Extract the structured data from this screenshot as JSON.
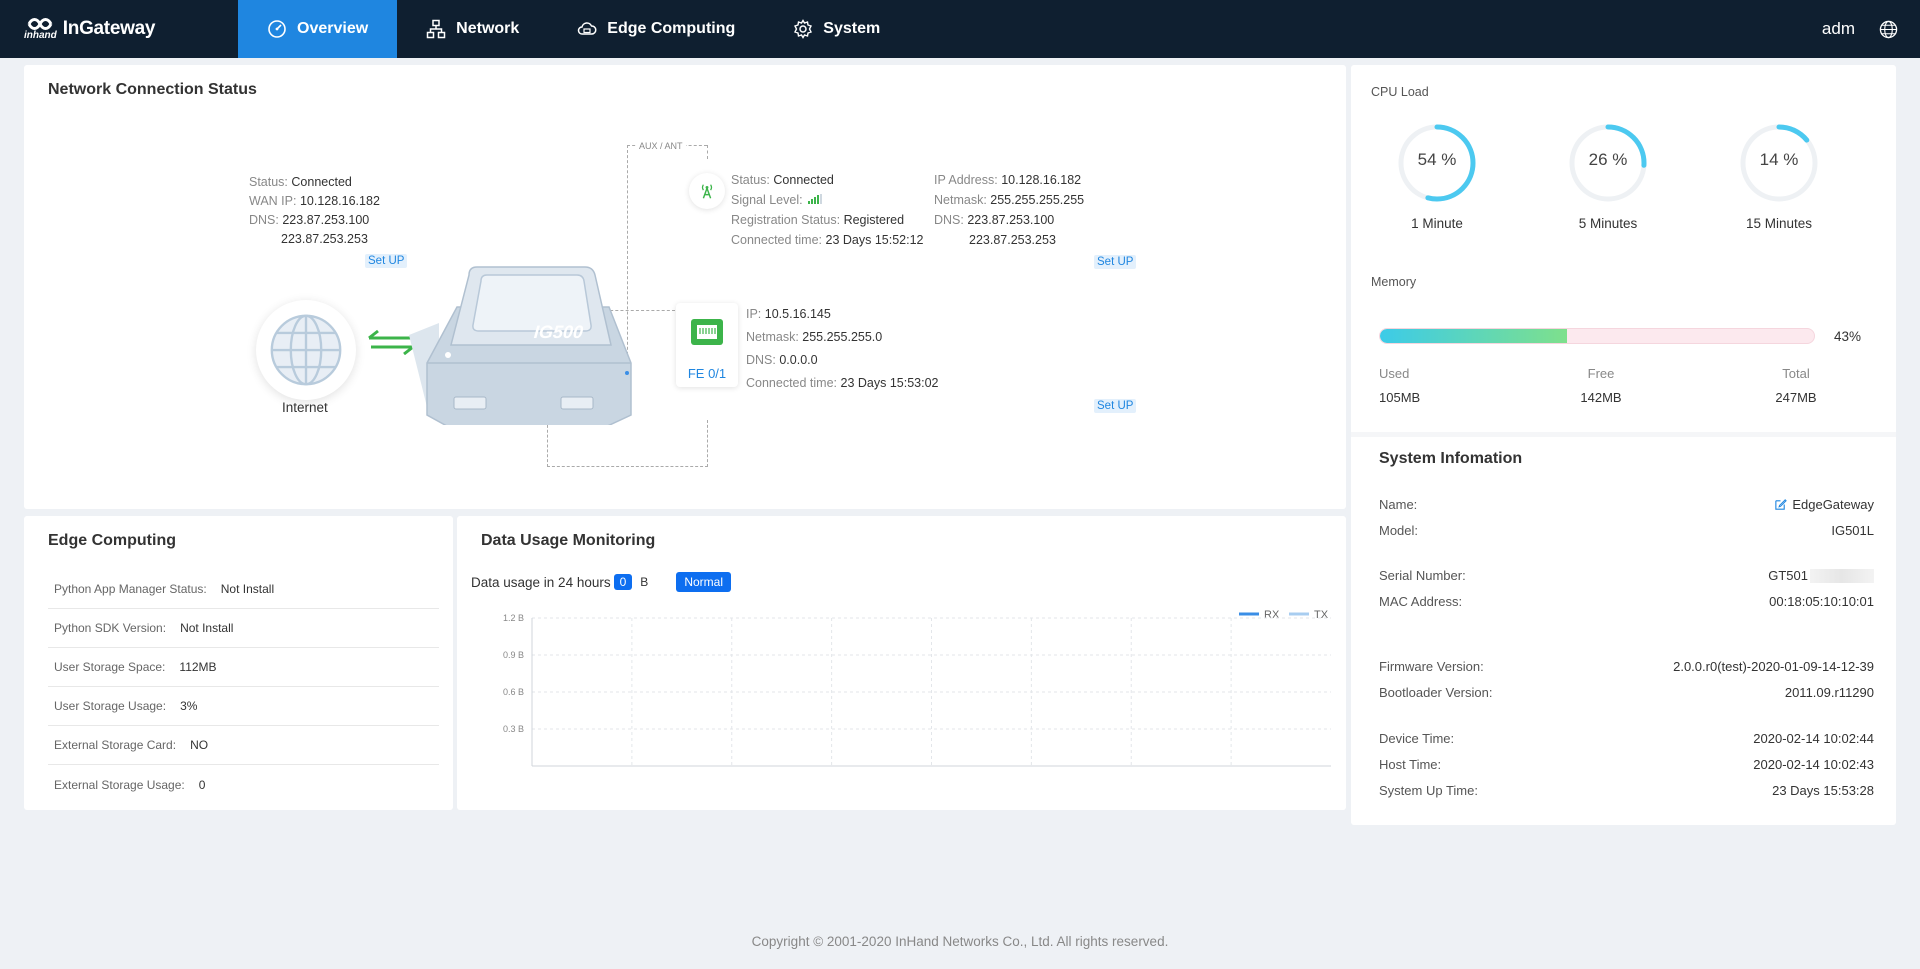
{
  "brand": {
    "logo_mark": "inhand",
    "name": "InGateway"
  },
  "nav": {
    "items": [
      {
        "label": "Overview",
        "icon": "dashboard-icon",
        "active": true
      },
      {
        "label": "Network",
        "icon": "network-icon"
      },
      {
        "label": "Edge Computing",
        "icon": "cloud-icon"
      },
      {
        "label": "System",
        "icon": "gear-icon"
      }
    ],
    "user": "adm"
  },
  "network_status": {
    "title": "Network Connection Status",
    "aux_label": "AUX / ANT",
    "device_label": "IG500",
    "internet_label": "Internet",
    "wan": {
      "status_k": "Status:",
      "status_v": "Connected",
      "ip_k": "WAN IP:",
      "ip_v": "10.128.16.182",
      "dns_k": "DNS:",
      "dns_v1": "223.87.253.100",
      "dns_v2": "223.87.253.253",
      "setup": "Set UP"
    },
    "cellular": {
      "status_k": "Status:",
      "status_v": "Connected",
      "signal_k": "Signal Level:",
      "signal_bars": 4,
      "reg_k": "Registration Status:",
      "reg_v": "Registered",
      "time_k": "Connected time:",
      "time_v": "23 Days 15:52:12",
      "ip_k": "IP Address:",
      "ip_v": "10.128.16.182",
      "mask_k": "Netmask:",
      "mask_v": "255.255.255.255",
      "dns_k": "DNS:",
      "dns_v1": "223.87.253.100",
      "dns_v2": "223.87.253.253",
      "setup": "Set UP"
    },
    "lan": {
      "port": "FE 0/1",
      "ip_k": "IP:",
      "ip_v": "10.5.16.145",
      "mask_k": "Netmask:",
      "mask_v": "255.255.255.0",
      "dns_k": "DNS:",
      "dns_v": "0.0.0.0",
      "time_k": "Connected time:",
      "time_v": "23 Days 15:53:02",
      "setup": "Set UP"
    }
  },
  "edge": {
    "title": "Edge Computing",
    "rows": [
      {
        "k": "Python App Manager Status:",
        "v": "Not Install"
      },
      {
        "k": "Python SDK Version:",
        "v": "Not Install"
      },
      {
        "k": "User Storage Space:",
        "v": "112MB"
      },
      {
        "k": "User Storage Usage:",
        "v": "3%"
      },
      {
        "k": "External Storage Card:",
        "v": "NO"
      },
      {
        "k": "External Storage Usage:",
        "v": "0"
      }
    ]
  },
  "data_usage": {
    "title": "Data Usage Monitoring",
    "label": "Data usage in 24 hours",
    "value": "0",
    "unit": "B",
    "status": "Normal"
  },
  "chart_data": {
    "type": "line",
    "series": [
      {
        "name": "RX",
        "values": [],
        "color": "#3a8ee6"
      },
      {
        "name": "TX",
        "values": [],
        "color": "#a8cdf0"
      }
    ],
    "yticks": [
      "1.2 B",
      "0.9 B",
      "0.6 B",
      "0.3 B"
    ],
    "ylim": [
      0,
      1.2
    ],
    "grid": true,
    "legend": "top-right"
  },
  "cpu": {
    "title": "CPU Load",
    "gauges": [
      {
        "value": 54,
        "text": "54 %",
        "label": "1 Minute"
      },
      {
        "value": 26,
        "text": "26 %",
        "label": "5 Minutes"
      },
      {
        "value": 14,
        "text": "14 %",
        "label": "15 Minutes"
      }
    ]
  },
  "memory": {
    "title": "Memory",
    "percent": 43,
    "percent_text": "43%",
    "used_k": "Used",
    "used_v": "105MB",
    "free_k": "Free",
    "free_v": "142MB",
    "total_k": "Total",
    "total_v": "247MB"
  },
  "system": {
    "title": "System Infomation",
    "name_k": "Name:",
    "name_v": "EdgeGateway",
    "model_k": "Model:",
    "model_v": "IG501L",
    "serial_k": "Serial Number:",
    "serial_v": "GT501",
    "mac_k": "MAC Address:",
    "mac_v": "00:18:05:10:10:01",
    "fw_k": "Firmware Version:",
    "fw_v": "2.0.0.r0(test)-2020-01-09-14-12-39",
    "bl_k": "Bootloader Version:",
    "bl_v": "2011.09.r11290",
    "dt_k": "Device Time:",
    "dt_v": "2020-02-14 10:02:44",
    "ht_k": "Host Time:",
    "ht_v": "2020-02-14 10:02:43",
    "up_k": "System Up Time:",
    "up_v": "23 Days 15:53:28"
  },
  "footer": {
    "text": "Copyright © 2001-2020 InHand Networks Co., Ltd. All rights reserved."
  },
  "colors": {
    "nav_bg": "#0f1f30",
    "accent": "#1f86e0",
    "badge": "#0d6ef0",
    "gauge": "#4cc9f0"
  }
}
